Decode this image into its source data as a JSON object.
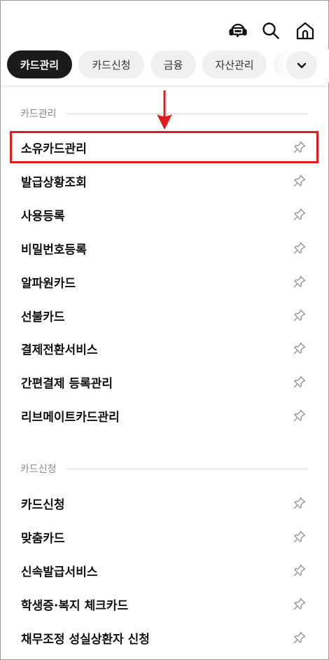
{
  "chips": [
    {
      "label": "카드관리",
      "active": true
    },
    {
      "label": "카드신청",
      "active": false
    },
    {
      "label": "금융",
      "active": false
    },
    {
      "label": "자산관리",
      "active": false
    }
  ],
  "icons": {
    "chat": "headset-chat-icon",
    "search": "search-icon",
    "home": "home-icon",
    "toggle": "chevron-down-icon",
    "pin": "pin-icon"
  },
  "sections": [
    {
      "title": "카드관리",
      "items": [
        "소유카드관리",
        "발급상황조회",
        "사용등록",
        "비밀번호등록",
        "알파원카드",
        "선불카드",
        "결제전환서비스",
        "간편결제 등록관리",
        "리브메이트카드관리"
      ]
    },
    {
      "title": "카드신청",
      "items": [
        "카드신청",
        "맞춤카드",
        "신속발급서비스",
        "학생증·복지 체크카드",
        "채무조정 성실상환자 신청"
      ]
    }
  ],
  "colors": {
    "highlight": "#e11c1c",
    "active_chip": "#1b1b1b",
    "chip": "#f0f0f2"
  }
}
